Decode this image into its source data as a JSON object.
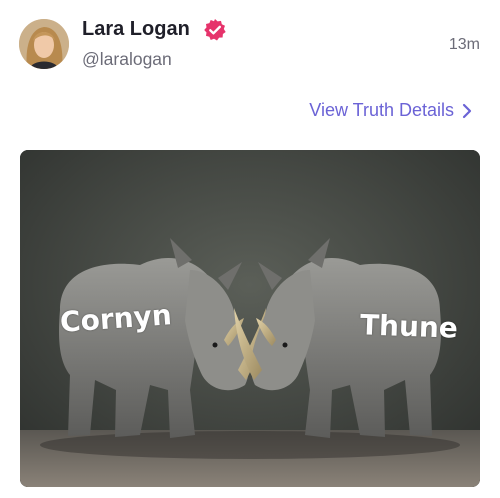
{
  "post": {
    "display_name": "Lara Logan",
    "handle": "@laralogan",
    "timestamp": "13m",
    "details_link": "View Truth Details"
  },
  "image": {
    "left_label": "Cornyn",
    "right_label": "Thune"
  },
  "colors": {
    "accent": "#6b63d6",
    "verified": "#e6336b",
    "name_text": "#1f1f29",
    "muted_text": "#6c6c78"
  },
  "icons": {
    "verified": "verified-badge-icon",
    "chevron": "chevron-right-icon"
  }
}
